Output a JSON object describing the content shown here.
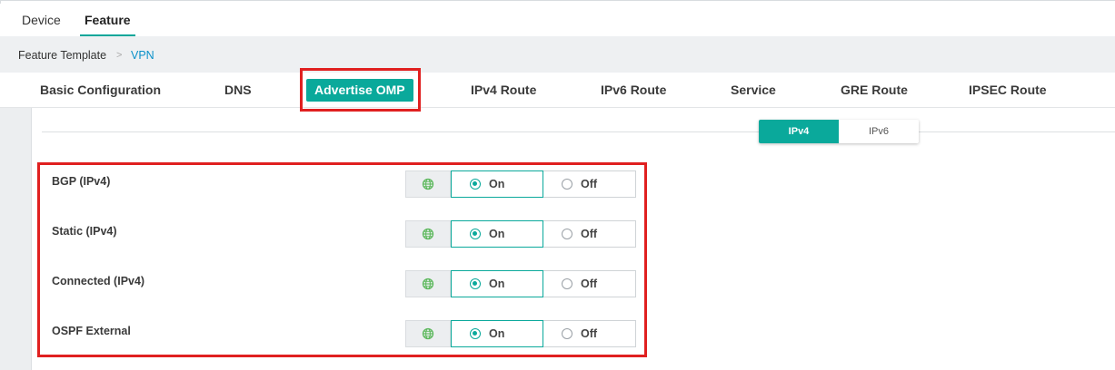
{
  "top_tabs": [
    {
      "label": "Device",
      "active": false
    },
    {
      "label": "Feature",
      "active": true
    }
  ],
  "breadcrumb": {
    "root": "Feature Template",
    "separator": ">",
    "current": "VPN"
  },
  "section_tabs": [
    {
      "label": "Basic Configuration",
      "active": false
    },
    {
      "label": "DNS",
      "active": false
    },
    {
      "label": "Advertise OMP",
      "active": true
    },
    {
      "label": "IPv4 Route",
      "active": false
    },
    {
      "label": "IPv6 Route",
      "active": false
    },
    {
      "label": "Service",
      "active": false
    },
    {
      "label": "GRE Route",
      "active": false
    },
    {
      "label": "IPSEC Route",
      "active": false
    }
  ],
  "ip_toggle": {
    "options": [
      "IPv4",
      "IPv6"
    ],
    "selected": "IPv4"
  },
  "rows": [
    {
      "label": "BGP (IPv4)",
      "scope_icon": "globe-icon",
      "on_label": "On",
      "off_label": "Off",
      "value": "On"
    },
    {
      "label": "Static (IPv4)",
      "scope_icon": "globe-icon",
      "on_label": "On",
      "off_label": "Off",
      "value": "On"
    },
    {
      "label": "Connected (IPv4)",
      "scope_icon": "globe-icon",
      "on_label": "On",
      "off_label": "Off",
      "value": "On"
    },
    {
      "label": "OSPF External",
      "scope_icon": "globe-icon",
      "on_label": "On",
      "off_label": "Off",
      "value": "On"
    }
  ],
  "colors": {
    "accent": "#0aa99b",
    "highlight": "#e02020",
    "link": "#0a91c9",
    "globe": "#5cb85c"
  }
}
